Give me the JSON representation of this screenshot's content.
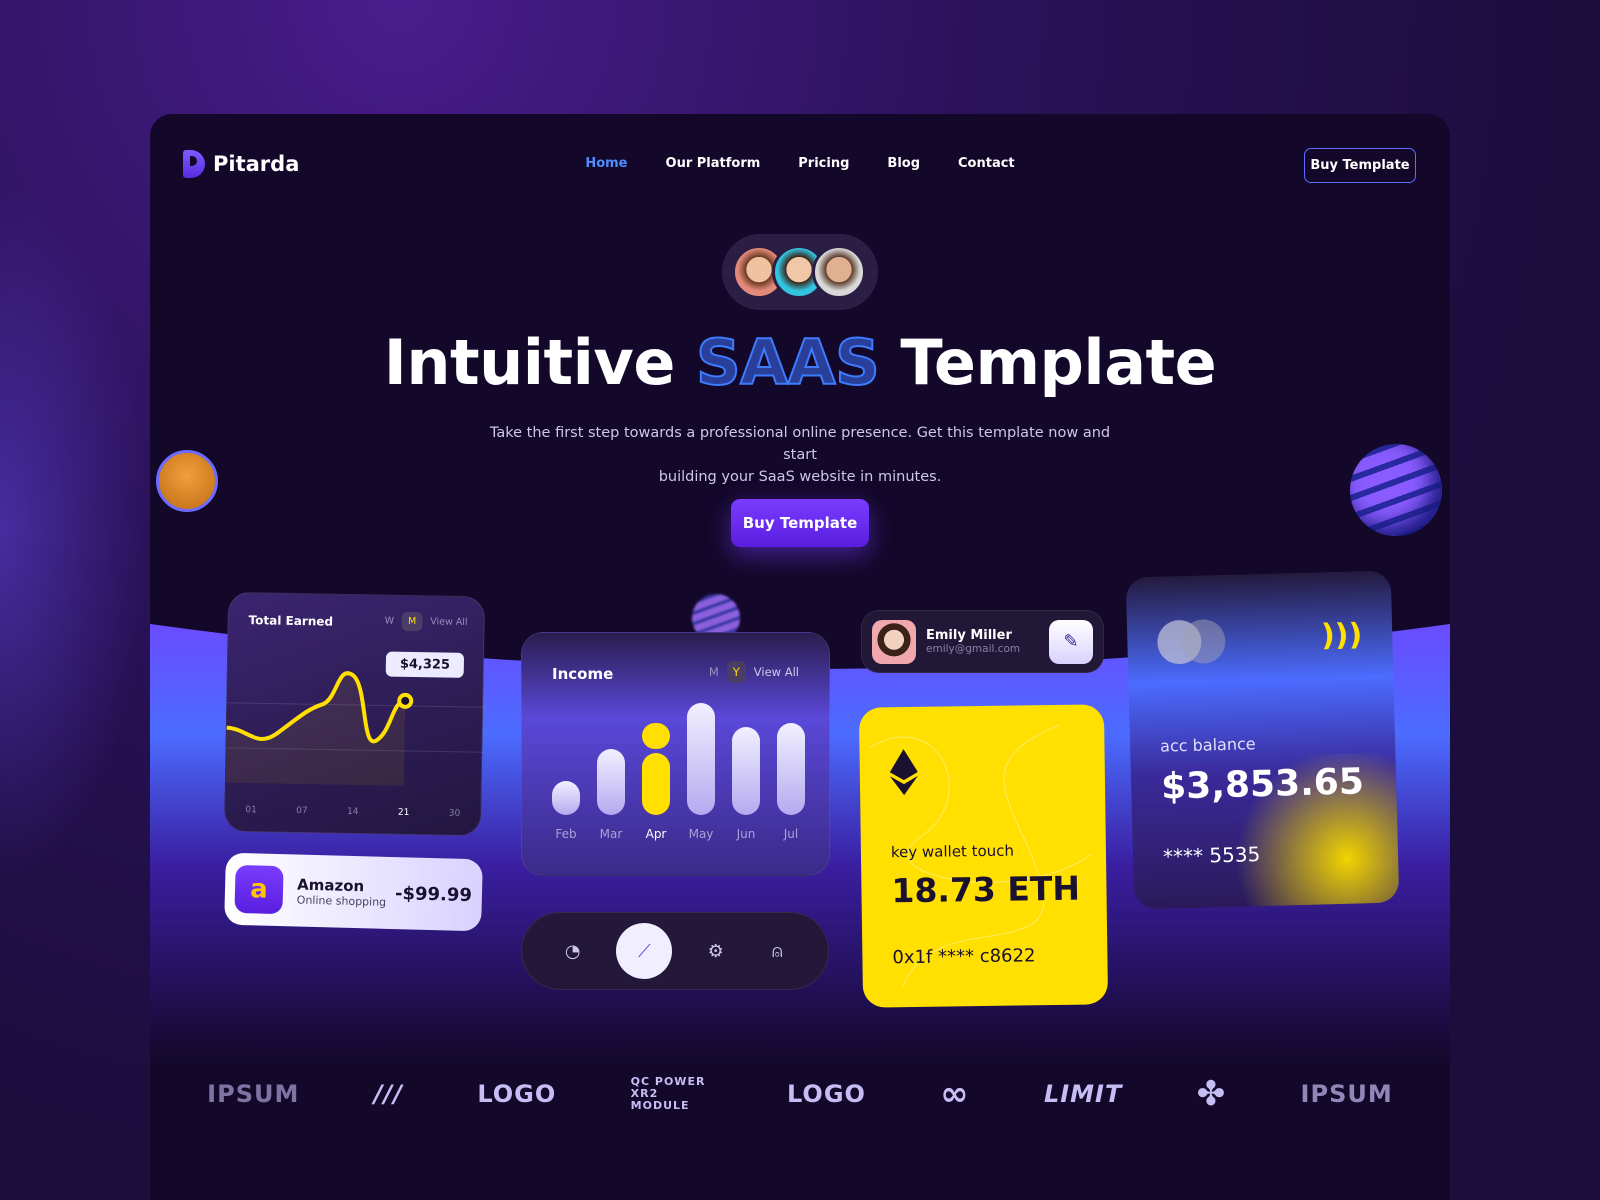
{
  "brand": {
    "name": "Pitarda"
  },
  "nav": {
    "items": [
      "Home",
      "Our Platform",
      "Pricing",
      "Blog",
      "Contact"
    ],
    "active": "Home",
    "cta": "Buy Template"
  },
  "hero": {
    "title_pre": "Intuitive",
    "title_accent": "SAAS",
    "title_post": "Template",
    "subtitle_1": "Take the first step towards a professional online presence. Get this template now and start",
    "subtitle_2": "building your SaaS website in minutes.",
    "cta": "Buy Template"
  },
  "colors": {
    "accent_blue": "#3d7bff",
    "accent_purple": "#6a2cf0",
    "yellow": "#ffe000",
    "background": "#13082a"
  },
  "earned": {
    "title": "Total Earned",
    "toggle": [
      "W",
      "M"
    ],
    "selected": "M",
    "view_all": "View All",
    "tooltip": "$4,325",
    "x_labels": [
      "01",
      "07",
      "14",
      "21",
      "30"
    ],
    "highlight": "21"
  },
  "amazon": {
    "icon_letter": "a",
    "name": "Amazon",
    "category": "Online shopping",
    "amount": "-$99.99"
  },
  "income": {
    "title": "Income",
    "toggle": [
      "M",
      "Y"
    ],
    "selected": "Y",
    "view_all": "View All",
    "months": [
      "Feb",
      "Mar",
      "Apr",
      "May",
      "Jun",
      "Jul"
    ],
    "highlight": "Apr"
  },
  "tabbar": {
    "icons": [
      "pie-chart-icon",
      "trend-chart-icon",
      "gear-icon",
      "user-icon"
    ],
    "active": "trend-chart-icon"
  },
  "profile": {
    "name": "Emily Miller",
    "email": "emily@gmail.com"
  },
  "wallet": {
    "label": "key wallet touch",
    "amount": "18.73 ETH",
    "address": "0x1f **** c8622"
  },
  "balance": {
    "label": "acc balance",
    "amount": "$3,853.65",
    "card": "**** 5535"
  },
  "brands": [
    "IPSUM",
    "///",
    "LOGO",
    "QC POWER XR2 MODULE",
    "LOGO",
    "∞",
    "LIMIT",
    "✤",
    "IPSUM"
  ]
}
